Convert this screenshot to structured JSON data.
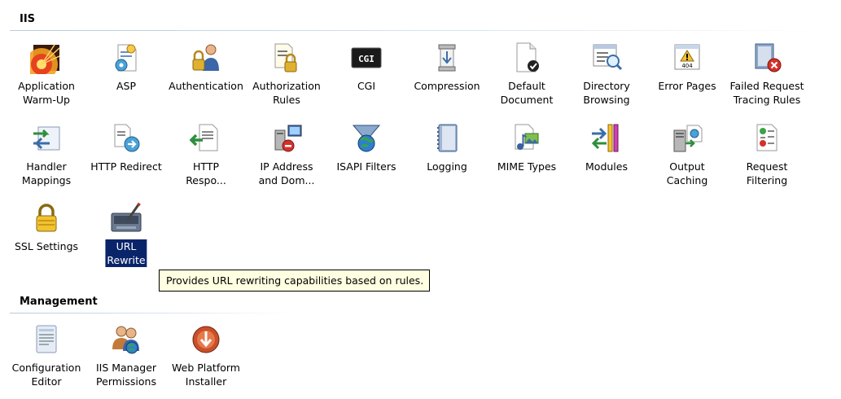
{
  "iis_section": {
    "title": "IIS",
    "items": [
      {
        "label": "Application\nWarm-Up",
        "icon": "warmup-icon"
      },
      {
        "label": "ASP",
        "icon": "asp-icon"
      },
      {
        "label": "Authentication",
        "icon": "authentication-icon"
      },
      {
        "label": "Authorization\nRules",
        "icon": "authorization-icon"
      },
      {
        "label": "CGI",
        "icon": "cgi-icon"
      },
      {
        "label": "Compression",
        "icon": "compression-icon"
      },
      {
        "label": "Default\nDocument",
        "icon": "default-document-icon"
      },
      {
        "label": "Directory\nBrowsing",
        "icon": "directory-browsing-icon"
      },
      {
        "label": "Error Pages",
        "icon": "error-pages-icon"
      },
      {
        "label": "Failed Request\nTracing Rules",
        "icon": "failed-request-icon"
      },
      {
        "label": "Handler\nMappings",
        "icon": "handler-mappings-icon"
      },
      {
        "label": "HTTP Redirect",
        "icon": "http-redirect-icon"
      },
      {
        "label": "HTTP\nRespo...",
        "icon": "http-response-icon"
      },
      {
        "label": "IP Address\nand Dom...",
        "icon": "ip-address-icon"
      },
      {
        "label": "ISAPI Filters",
        "icon": "isapi-filters-icon"
      },
      {
        "label": "Logging",
        "icon": "logging-icon"
      },
      {
        "label": "MIME Types",
        "icon": "mime-types-icon"
      },
      {
        "label": "Modules",
        "icon": "modules-icon"
      },
      {
        "label": "Output\nCaching",
        "icon": "output-caching-icon"
      },
      {
        "label": "Request\nFiltering",
        "icon": "request-filtering-icon"
      },
      {
        "label": "SSL Settings",
        "icon": "ssl-settings-icon"
      },
      {
        "label": "URL Rewrite",
        "icon": "url-rewrite-icon",
        "selected": true
      }
    ]
  },
  "tooltip": {
    "text": "Provides URL rewriting capabilities based on rules."
  },
  "management_section": {
    "title": "Management",
    "items": [
      {
        "label": "Configuration\nEditor",
        "icon": "configuration-editor-icon"
      },
      {
        "label": "IIS Manager\nPermissions",
        "icon": "iis-manager-permissions-icon"
      },
      {
        "label": "Web Platform\nInstaller",
        "icon": "web-platform-installer-icon"
      }
    ]
  },
  "colors": {
    "selection_bg": "#0a246a",
    "tooltip_bg": "#ffffe1",
    "header_rule": "#b9c9dc"
  }
}
